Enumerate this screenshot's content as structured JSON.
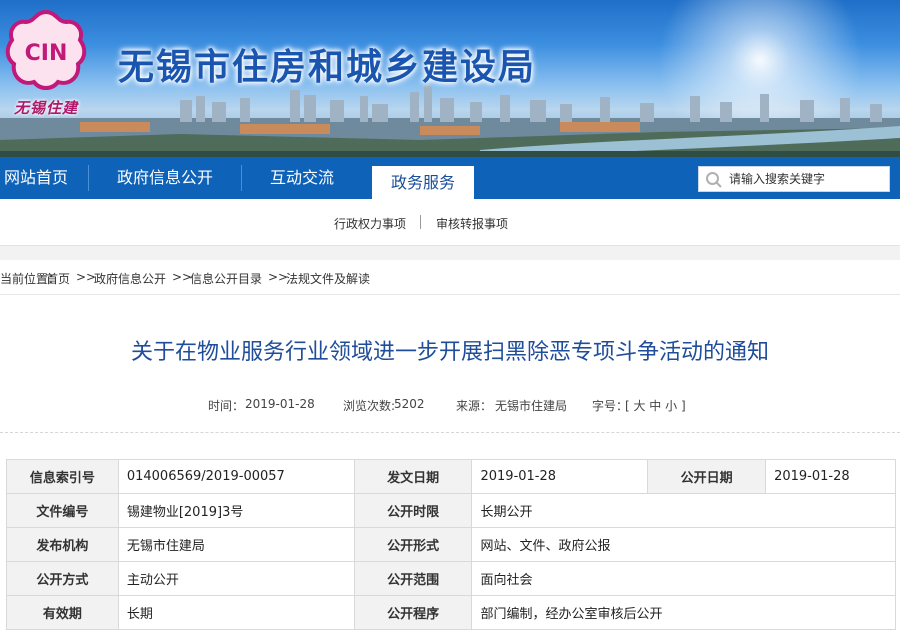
{
  "header": {
    "logo_text": "CIN",
    "logo_script": "无锡住建",
    "site_title": "无锡市住房和城乡建设局"
  },
  "nav": {
    "items": [
      {
        "label": "网站首页",
        "active": false
      },
      {
        "label": "政府信息公开",
        "active": false
      },
      {
        "label": "互动交流",
        "active": false
      },
      {
        "label": "政务服务",
        "active": true
      }
    ],
    "search_placeholder": "请输入搜索关键字"
  },
  "subnav": {
    "items": [
      "行政权力事项",
      "审核转报事项"
    ]
  },
  "breadcrumb": {
    "prefix": "您当前位置：",
    "items": [
      "首页",
      "政府信息公开",
      "信息公开目录",
      "法规文件及解读"
    ],
    "separator": ">>"
  },
  "article": {
    "title": "关于在物业服务行业领域进一步开展扫黑除恶专项斗争活动的通知",
    "time_label": "时间：",
    "time": "2019-01-28",
    "views_label": "浏览次数:",
    "views": "5202",
    "source_label": "来源：",
    "source": "无锡市住建局",
    "font_label": "字号：",
    "font_sizes": "[ 大 中 小 ]"
  },
  "info_table": {
    "row1": {
      "k1": "信息索引号",
      "v1": "014006569/2019-00057",
      "k2": "发文日期",
      "v2": "2019-01-28",
      "k3": "公开日期",
      "v3": "2019-01-28"
    },
    "row2": {
      "k1": "文件编号",
      "v1": "锡建物业[2019]3号",
      "k2": "公开时限",
      "v2": "长期公开"
    },
    "row3": {
      "k1": "发布机构",
      "v1": "无锡市住建局",
      "k2": "公开形式",
      "v2": "网站、文件、政府公报"
    },
    "row4": {
      "k1": "公开方式",
      "v1": "主动公开",
      "k2": "公开范围",
      "v2": "面向社会"
    },
    "row5": {
      "k1": "有效期",
      "v1": "长期",
      "k2": "公开程序",
      "v2": "部门编制，经办公室审核后公开"
    }
  },
  "colors": {
    "nav_bg": "#0e62b8",
    "title_blue": "#1f4d9a",
    "logo_pink": "#c2187a"
  }
}
